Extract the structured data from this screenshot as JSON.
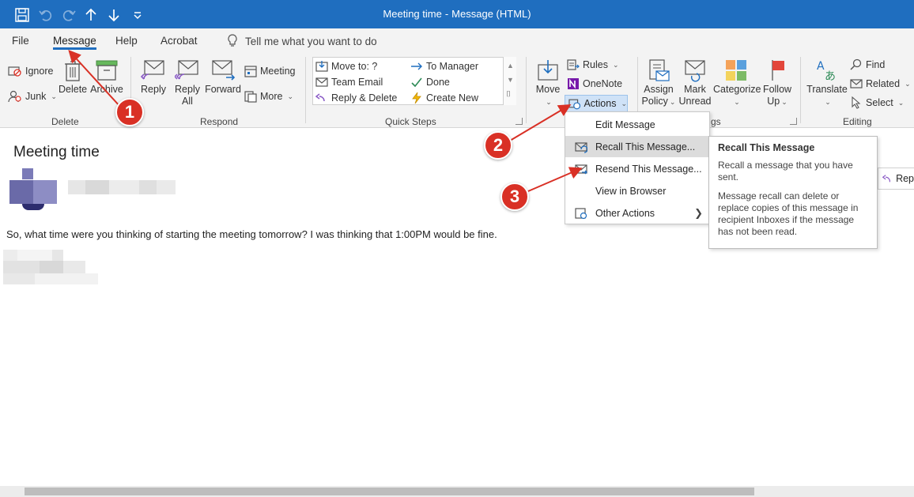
{
  "window": {
    "title": "Meeting time",
    "title_suffix": "Message (HTML)",
    "separator": "-"
  },
  "menu": {
    "items": [
      "File",
      "Message",
      "Help",
      "Acrobat"
    ],
    "active": "Message",
    "tell_me": "Tell me what you want to do"
  },
  "ribbon": {
    "delete_group": {
      "label": "Delete",
      "ignore": "Ignore",
      "junk": "Junk",
      "delete": "Delete",
      "archive": "Archive"
    },
    "respond_group": {
      "label": "Respond",
      "reply": "Reply",
      "reply_all_1": "Reply",
      "reply_all_2": "All",
      "forward": "Forward",
      "meeting": "Meeting",
      "more": "More"
    },
    "quick_steps": {
      "label": "Quick Steps",
      "move_to": "Move to: ?",
      "to_manager": "To Manager",
      "team_email": "Team Email",
      "done": "Done",
      "reply_delete": "Reply & Delete",
      "create_new": "Create New"
    },
    "move_group": {
      "move": "Move",
      "rules": "Rules",
      "onenote": "OneNote",
      "actions": "Actions"
    },
    "tags_group": {
      "label_fragment": "gs",
      "assign_policy_1": "Assign",
      "assign_policy_2": "Policy",
      "mark_unread_1": "Mark",
      "mark_unread_2": "Unread",
      "categorize": "Categorize",
      "follow_up_1": "Follow",
      "follow_up_2": "Up"
    },
    "editing_group": {
      "label": "Editing",
      "translate": "Translate",
      "find": "Find",
      "related": "Related",
      "select": "Select"
    }
  },
  "message": {
    "subject": "Meeting time",
    "body": "So, what time were you thinking of starting the meeting tomorrow? I was thinking that 1:00PM would be fine."
  },
  "actions_menu": {
    "items": [
      "Edit Message",
      "Recall This Message...",
      "Resend This Message...",
      "View in Browser",
      "Other Actions"
    ]
  },
  "tooltip": {
    "title": "Recall This Message",
    "line1": "Recall a message that you have sent.",
    "line2": "Message recall can delete or replace copies of this message in recipient Inboxes if the message has not been read."
  },
  "reply_peek": "Rep",
  "markers": [
    "1",
    "2",
    "3"
  ],
  "colors": {
    "title_bar": "#1f6ebf",
    "ribbon_bg": "#f3f3f3",
    "marker": "#d93025",
    "highlight": "#dcdcdc"
  }
}
